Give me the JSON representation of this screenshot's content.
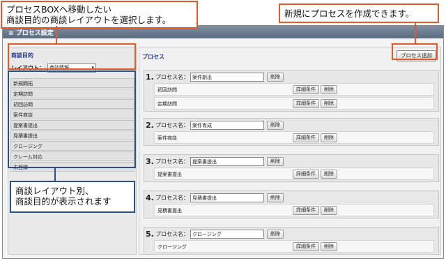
{
  "window": {
    "title": "プロセス設定"
  },
  "left_panel": {
    "heading": "商談目的",
    "layout_label": "レイアウト：",
    "layout_value": "商談情報",
    "purposes": [
      "新規開拓",
      "定期訪問",
      "初回訪問",
      "案件商談",
      "提案書提出",
      "見積書提出",
      "クロージング",
      "クレーム対応",
      "未登録"
    ]
  },
  "right_panel": {
    "heading": "プロセス",
    "add_button": "プロセス追加",
    "process_label": "プロセス名：",
    "delete_label": "削除",
    "detail_label": "詳細条件",
    "processes": [
      {
        "num": "1.",
        "name": "案件創出",
        "tasks": [
          "初回訪問",
          "定期訪問"
        ]
      },
      {
        "num": "2.",
        "name": "案件育成",
        "tasks": [
          "案件商談"
        ]
      },
      {
        "num": "3.",
        "name": "提案書提出",
        "tasks": [
          "提案書提出"
        ]
      },
      {
        "num": "4.",
        "name": "見積書提出",
        "tasks": [
          "見積書提出"
        ]
      },
      {
        "num": "5.",
        "name": "クロージング",
        "tasks": [
          "クロージング"
        ]
      }
    ]
  },
  "callouts": {
    "top_left_line1": "プロセスBOXへ移動したい",
    "top_left_line2": "商談目的の商談レイアウトを選択します。",
    "top_right": "新規にプロセスを作成できます。",
    "bottom_line1": "商談レイアウト別、",
    "bottom_line2": "商談目的が表示されます"
  },
  "colors": {
    "callout_red": "#e05a2b",
    "callout_blue": "#2e4f86",
    "heading_blue": "#2b3a8a"
  }
}
